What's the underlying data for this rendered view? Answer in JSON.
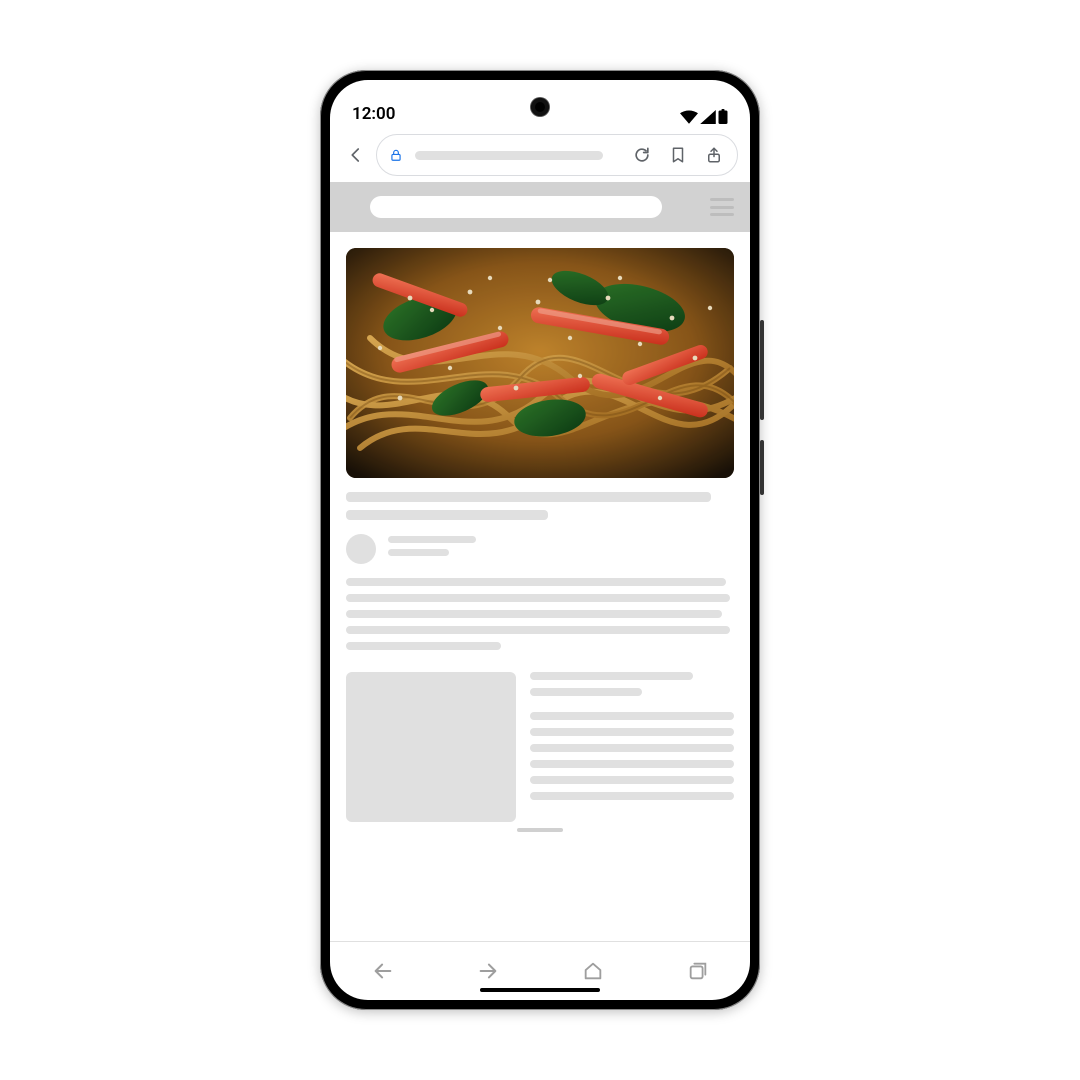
{
  "status": {
    "time": "12:00"
  },
  "browser": {
    "icons": {
      "back": "back-chevron",
      "lock": "lock-icon",
      "reload": "reload-icon",
      "bookmark": "bookmark-icon",
      "share": "share-icon"
    }
  },
  "navbar": {
    "icons": {
      "prev": "arrow-left-icon",
      "next": "arrow-right-icon",
      "home": "home-icon",
      "tabs": "tabs-icon"
    }
  },
  "site_header": {
    "menu": "hamburger-icon"
  },
  "hero": {
    "description": "Close-up photo of a noodle dish with red pepper strips, greens, and sesame seeds"
  }
}
